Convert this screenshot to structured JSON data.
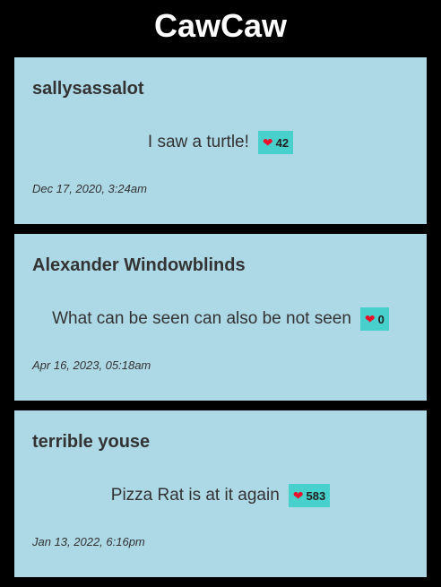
{
  "app": {
    "title": "CawCaw"
  },
  "colors": {
    "background": "#000000",
    "card": "#add8e6",
    "like_button": "#48d1cc",
    "heart": "#e8102a"
  },
  "posts": [
    {
      "author": "sallysassalot",
      "text": "I saw a turtle!",
      "likes": "42",
      "date": "Dec 17, 2020, 3:24am"
    },
    {
      "author": "Alexander Windowblinds",
      "text": "What can be seen can also be not seen",
      "likes": "0",
      "date": "Apr 16, 2023, 05:18am"
    },
    {
      "author": "terrible youse",
      "text": "Pizza Rat is at it again",
      "likes": "583",
      "date": "Jan 13, 2022, 6:16pm"
    }
  ]
}
